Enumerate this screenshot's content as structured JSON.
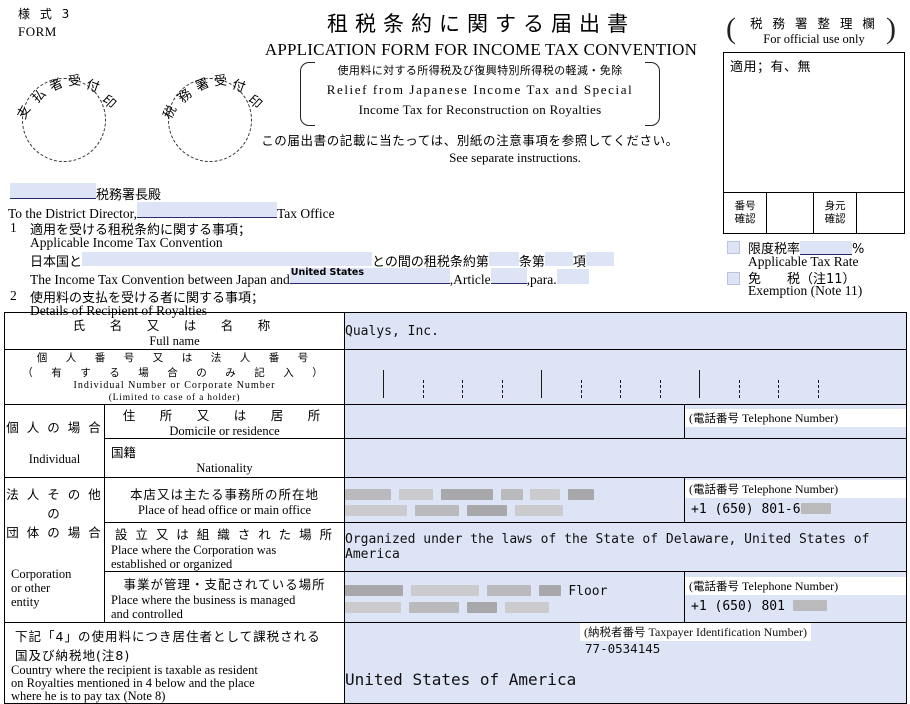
{
  "form": {
    "number_jp": "様 式 3",
    "number_en": "FORM",
    "title_jp": "租税条約に関する届出書",
    "title_en": "APPLICATION FORM FOR INCOME TAX CONVENTION",
    "subtitle_jp": "使用料に対する所得税及び復興特別所得税の軽減・免除",
    "subtitle_en_line1": "Relief from Japanese Income Tax and Special",
    "subtitle_en_line2": "Income Tax for Reconstruction on Royalties",
    "instruction_jp": "この届出書の記載に当たっては、別紙の注意事項を参照してください。",
    "instruction_en": "See separate instructions."
  },
  "stamps": {
    "payer": {
      "chars": [
        "支",
        "払",
        "者",
        "受",
        "付",
        "印"
      ]
    },
    "tax_office": {
      "chars": [
        "税",
        "務",
        "署",
        "受",
        "付",
        "印"
      ]
    }
  },
  "official_use": {
    "header_jp": "税 務 署 整 理 欄",
    "header_en": "For official use only",
    "apply_label": "適用；有、無",
    "footer": [
      {
        "label_line1": "番号",
        "label_line2": "確認"
      },
      {
        "label_line1": "",
        "label_line2": ""
      },
      {
        "label_line1": "身元",
        "label_line2": "確認"
      },
      {
        "label_line1": "",
        "label_line2": ""
      }
    ],
    "rate_jp": "限度税率",
    "rate_value": "",
    "rate_percent": "%",
    "rate_en": "Applicable Tax Rate",
    "exemption_jp": "免　　税（注11）",
    "exemption_en": "Exemption (Note 11)"
  },
  "district": {
    "office_value": "",
    "suffix_jp": "税務署長殿",
    "prefix_en": "To the District Director,",
    "suffix_en": "Tax Office"
  },
  "section1": {
    "number": "1",
    "heading_jp": "適用を受ける租税条約に関する事項；",
    "heading_en": "Applicable Income Tax Convention",
    "jp_prefix": "日本国と",
    "jp_country_value": "",
    "jp_suffix": "との間の租税条約第",
    "jp_article_value": "",
    "jp_mid": "条第",
    "jp_para_value": "",
    "jp_end": "項",
    "jp_tail_value": "",
    "en_prefix": "The Income Tax Convention between Japan and",
    "en_country_value": "United States",
    "en_comma": ",",
    "en_article_label": "Article",
    "en_article_value": "",
    "en_para_label": ",para.",
    "en_para_value": ""
  },
  "section2": {
    "number": "2",
    "heading_jp": "使用料の支払を受ける者に関する事項；",
    "heading_en": "Details of Recipient of Royalties"
  },
  "table": {
    "full_name": {
      "label_jp": "氏　名　又　は　名　称",
      "label_en": "Full name",
      "value": "Qualys, Inc."
    },
    "corporate_number": {
      "label_jp_line1": "個　人　番　号　又　は　法　人　番　号",
      "label_jp_line2": "（　有　す　る　場　合　の　み　記　入　）",
      "label_en_line1": "Individual Number or Corporate Number",
      "label_en_line2": "(Limited to case of a holder)",
      "value": ""
    },
    "individual": {
      "label_jp": "個 人 の 場 合",
      "label_en": "Individual",
      "domicile": {
        "label_jp": "住　所　又　は　居　所",
        "label_en": "Domicile or residence",
        "value": "",
        "tel_label_jp": "電話番号",
        "tel_label_en": "Telephone Number",
        "tel_value": ""
      },
      "nationality": {
        "label_jp_left": "国",
        "label_jp_right": "籍",
        "label_en": "Nationality",
        "value": ""
      }
    },
    "corporation": {
      "label_jp": "法 人 そ の 他 の\n団 体 の 場 合",
      "label_en": "Corporation\nor other\nentity",
      "head_office": {
        "label_jp": "本店又は主たる事務所の所在地",
        "label_en": "Place of head office or main office",
        "value_redacted": true,
        "tel_label_jp": "電話番号",
        "tel_label_en": "Telephone Number",
        "tel_value": "+1 (650) 801-6"
      },
      "established": {
        "label_jp": "設 立 又 は 組 織 さ れ た 場 所",
        "label_en_line1": "Place where the Corporation was",
        "label_en_line2": "established or organized",
        "value": "Organized under the laws of the State of Delaware, United States of America"
      },
      "managed": {
        "label_jp": "事業が管理・支配されている場所",
        "label_en_line1": "Place where the business is managed",
        "label_en_line2": "and controlled",
        "value_prefix": "",
        "value_suffix": "Floor",
        "tel_label_jp": "電話番号",
        "tel_label_en": "Telephone Number",
        "tel_value": "+1 (650) 801"
      }
    },
    "tax_country": {
      "label_jp_line1": "下記「4」の使用料につき居住者として課税される",
      "label_jp_line2": "国及び納税地(注8)",
      "label_en_line1": "Country where the recipient is taxable as resident",
      "label_en_line2": "on Royalties mentioned in 4 below and the place",
      "label_en_line3": "where he is to pay tax (Note 8)",
      "value": "United States of America",
      "tin_label_jp": "納税者番号",
      "tin_label_en": "Taxpayer Identification Number",
      "tin_value": "77-0534145"
    }
  },
  "colors": {
    "field_fill": "#dde4f6",
    "border": "#000000",
    "redaction": "#b6b6b6"
  }
}
